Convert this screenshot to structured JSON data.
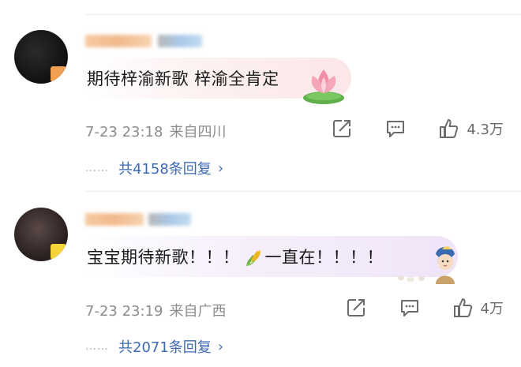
{
  "comments": [
    {
      "text": "期待梓渝新歌 梓渝全肯定",
      "time": "7-23 23:18",
      "location": "来自四川",
      "likes": "4.3万",
      "replies_label": "共4158条回复",
      "reply_dots": "……",
      "sticker_icon": "lotus-icon"
    },
    {
      "text_before": "宝宝期待新歌！！！",
      "text_after": "一直在！！！！",
      "inline_icon": "corn-icon",
      "time": "7-23 23:19",
      "location": "来自广西",
      "likes": "4万",
      "replies_label": "共2071条回复",
      "reply_dots": "……",
      "sticker_icon": "girl-with-pearl-earring-icon"
    }
  ],
  "colors": {
    "reply_link": "#3d6bb3",
    "meta_text": "#8c8c8c",
    "bubble_1": "#fdf1f1",
    "bubble_2": "#f6f0fb"
  },
  "icons": [
    "share-icon",
    "comment-icon",
    "like-icon"
  ]
}
